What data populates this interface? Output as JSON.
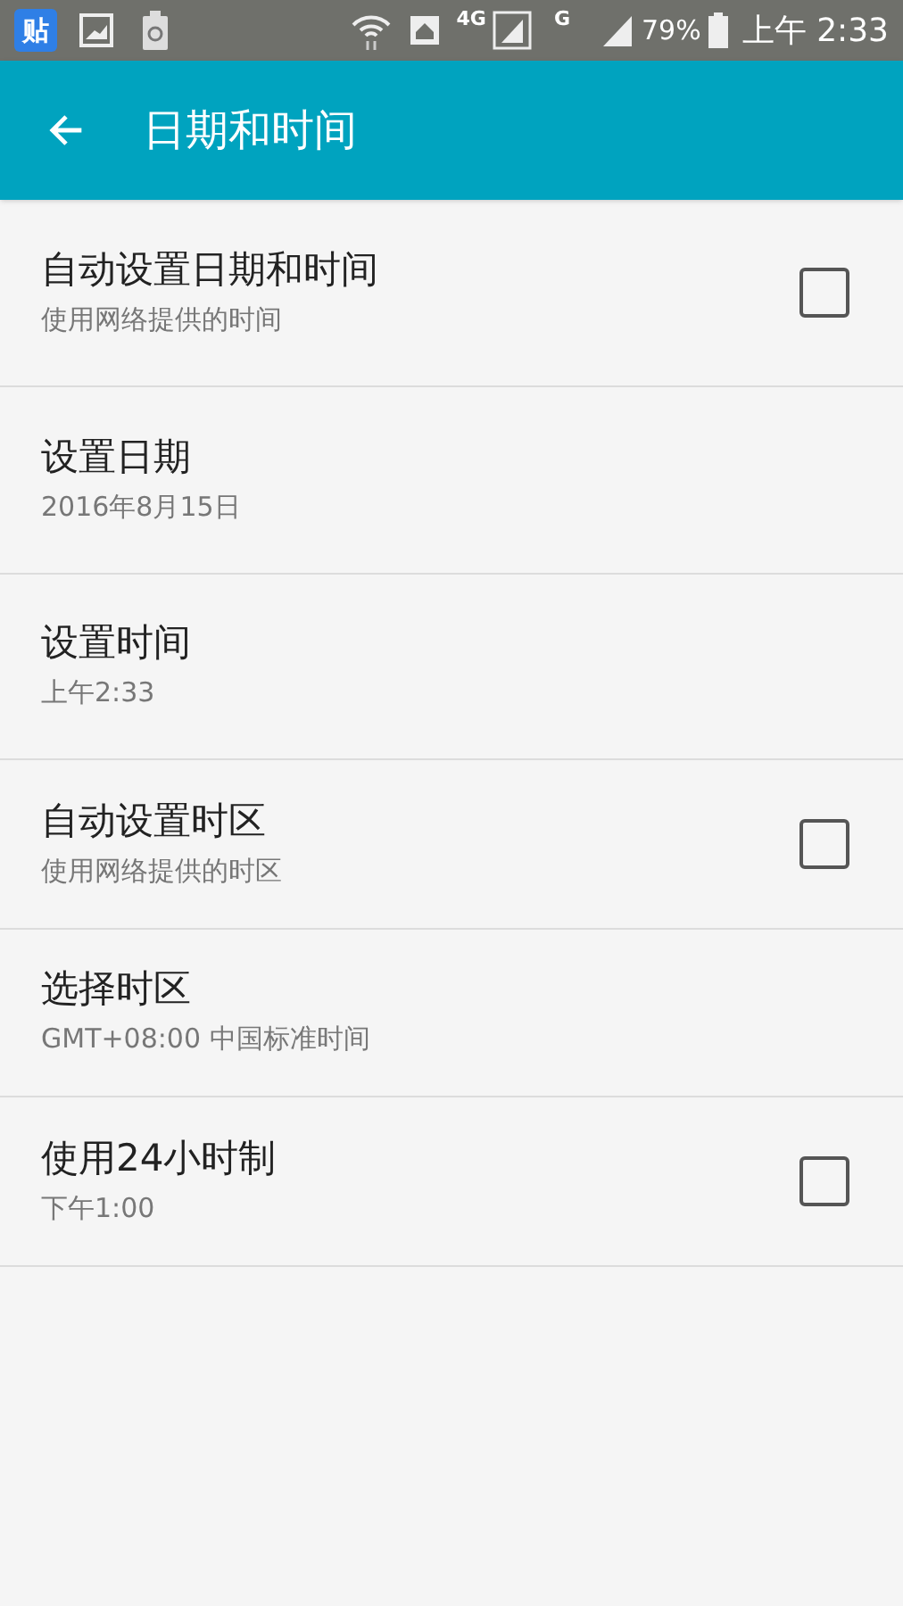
{
  "status_bar": {
    "app_badge": "贴",
    "network_4g": "4G",
    "network_g": "G",
    "battery": "79%",
    "time": "上午 2:33"
  },
  "app_bar": {
    "title": "日期和时间"
  },
  "settings": [
    {
      "kind": "checkbox",
      "title": "自动设置日期和时间",
      "summary": "使用网络提供的时间",
      "checked": false
    },
    {
      "kind": "plain",
      "title": "设置日期",
      "summary": "2016年8月15日"
    },
    {
      "kind": "plain",
      "title": "设置时间",
      "summary": "上午2:33"
    },
    {
      "kind": "checkbox",
      "title": "自动设置时区",
      "summary": "使用网络提供的时区",
      "checked": false
    },
    {
      "kind": "plain",
      "title": "选择时区",
      "summary": "GMT+08:00 中国标准时间"
    },
    {
      "kind": "checkbox",
      "title": "使用24小时制",
      "summary": "下午1:00",
      "checked": false
    }
  ]
}
